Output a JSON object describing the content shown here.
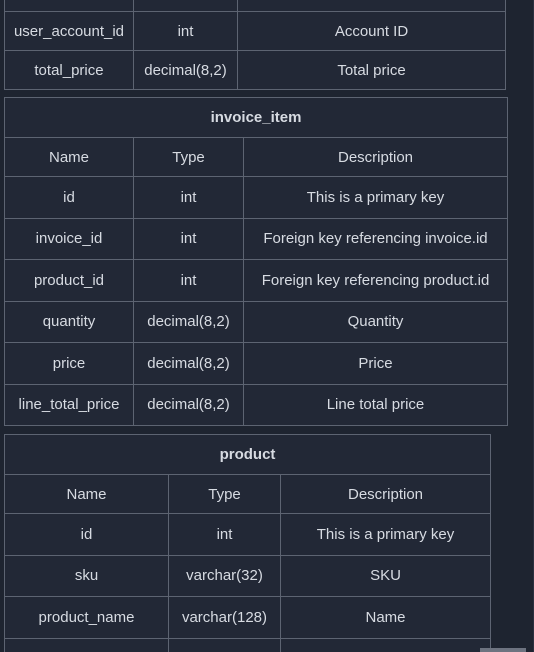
{
  "tables": {
    "invoice": {
      "rows": [
        {
          "name": "",
          "type": "",
          "description": ""
        },
        {
          "name": "user_account_id",
          "type": "int",
          "description": "Account ID"
        },
        {
          "name": "total_price",
          "type": "decimal(8,2)",
          "description": "Total price"
        }
      ]
    },
    "invoice_item": {
      "title": "invoice_item",
      "headers": {
        "name": "Name",
        "type": "Type",
        "description": "Description"
      },
      "rows": [
        {
          "name": "id",
          "type": "int",
          "description": "This is a primary key"
        },
        {
          "name": "invoice_id",
          "type": "int",
          "description": "Foreign key referencing invoice.id"
        },
        {
          "name": "product_id",
          "type": "int",
          "description": "Foreign key referencing product.id"
        },
        {
          "name": "quantity",
          "type": "decimal(8,2)",
          "description": "Quantity"
        },
        {
          "name": "price",
          "type": "decimal(8,2)",
          "description": "Price"
        },
        {
          "name": "line_total_price",
          "type": "decimal(8,2)",
          "description": "Line total price"
        }
      ]
    },
    "product": {
      "title": "product",
      "headers": {
        "name": "Name",
        "type": "Type",
        "description": "Description"
      },
      "rows": [
        {
          "name": "id",
          "type": "int",
          "description": "This is a primary key"
        },
        {
          "name": "sku",
          "type": "varchar(32)",
          "description": "SKU"
        },
        {
          "name": "product_name",
          "type": "varchar(128)",
          "description": "Name"
        },
        {
          "name": "",
          "type": "",
          "description": ""
        }
      ]
    }
  }
}
